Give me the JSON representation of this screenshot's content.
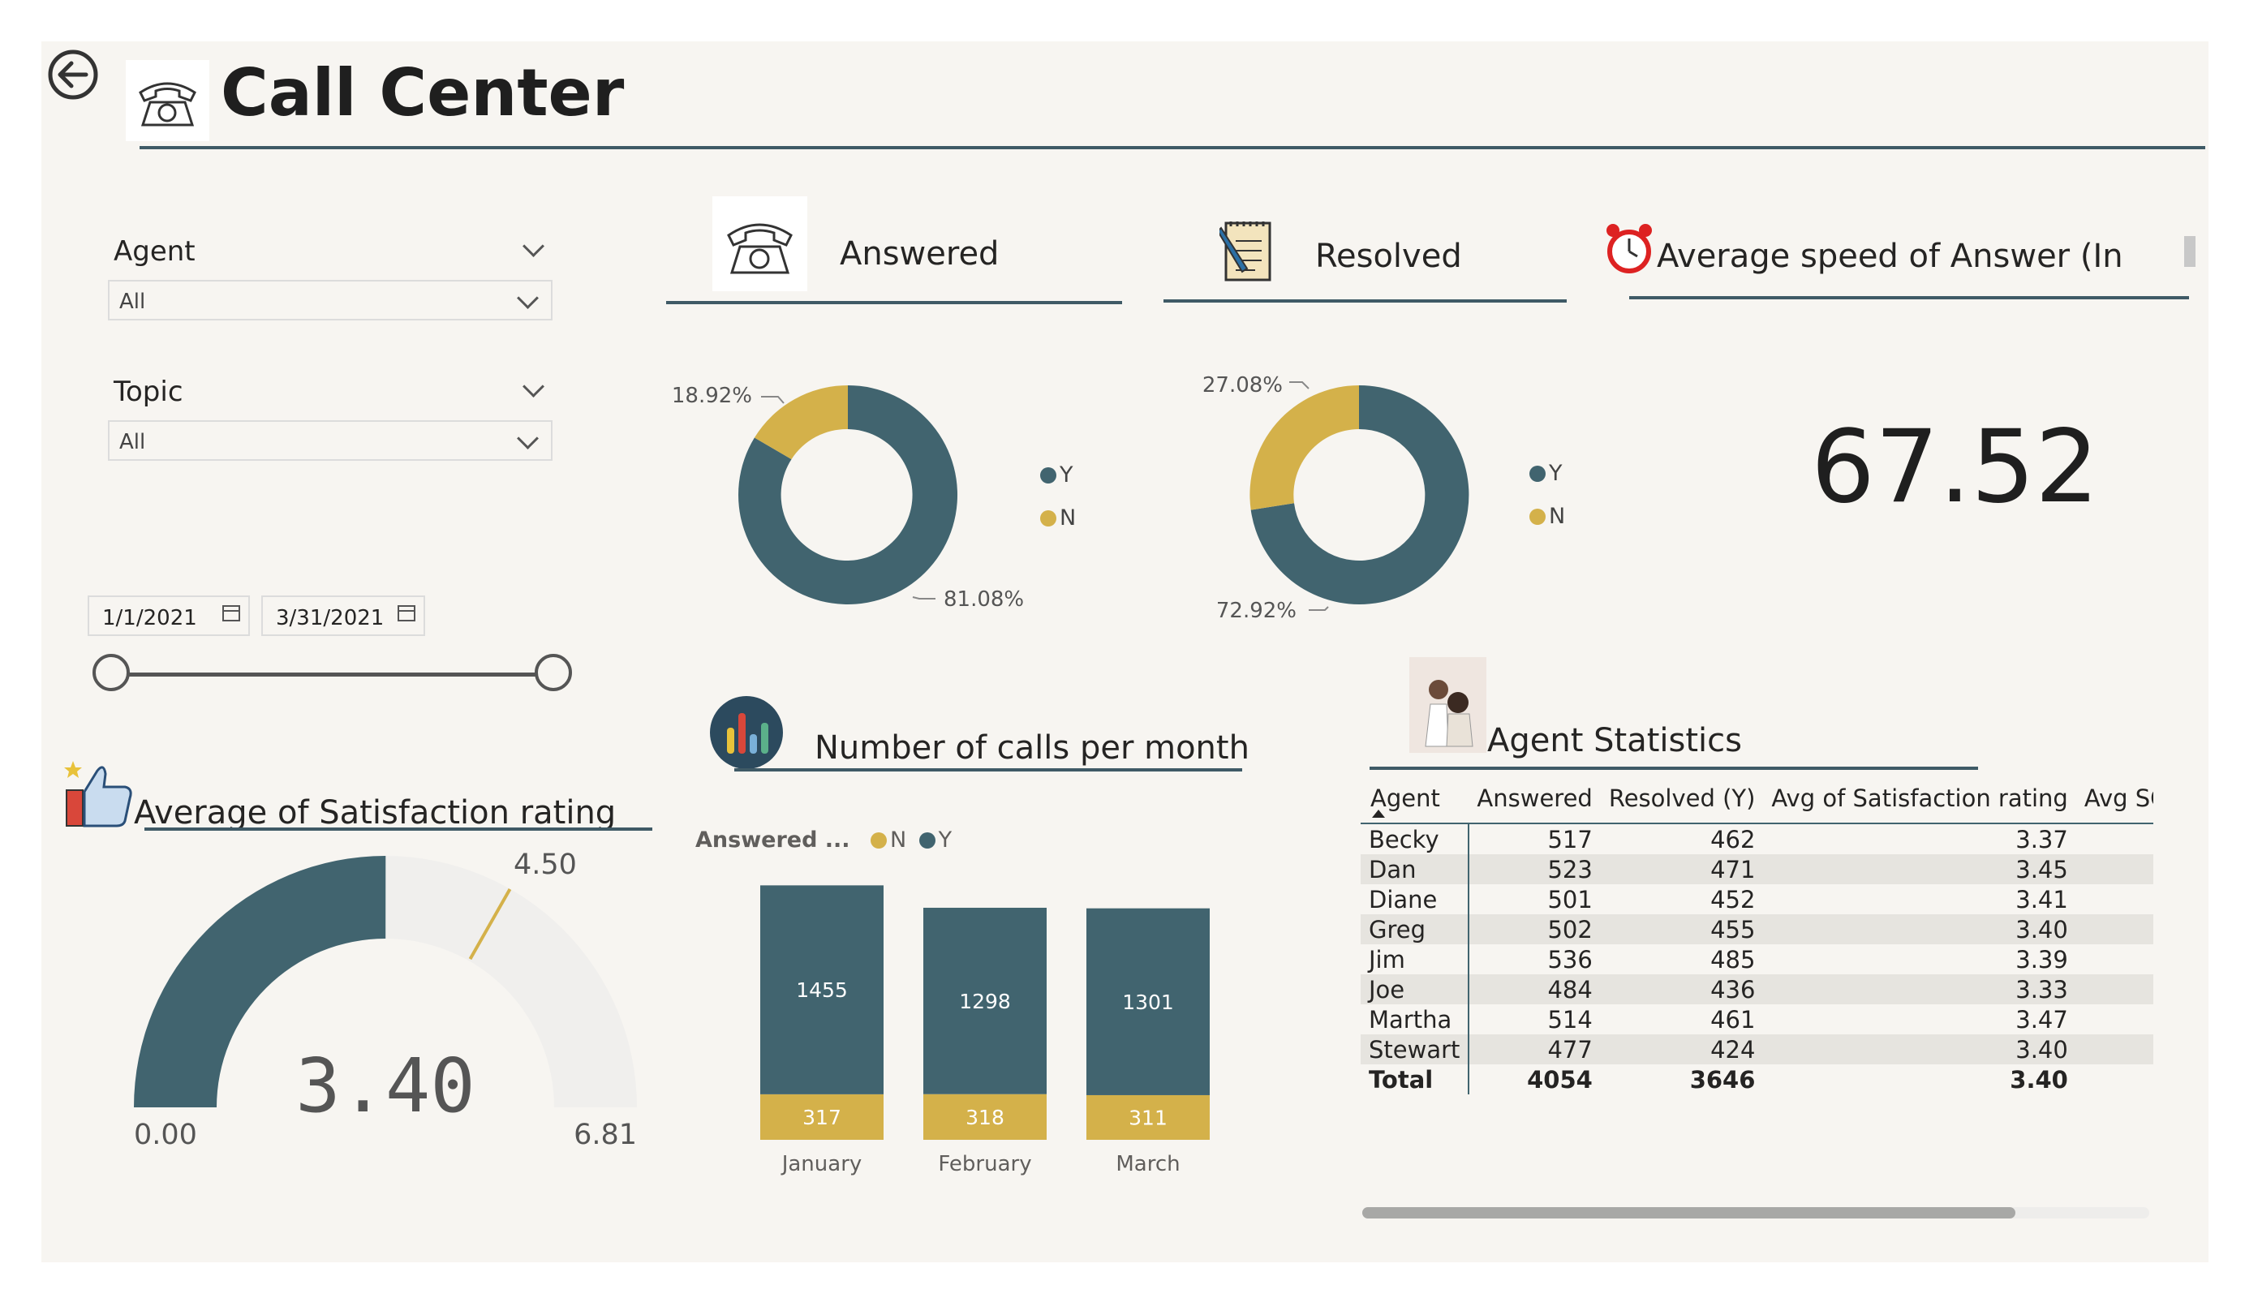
{
  "header": {
    "title": "Call Center"
  },
  "filters": {
    "agent": {
      "label": "Agent",
      "value": "All"
    },
    "topic": {
      "label": "Topic",
      "value": "All"
    },
    "date_start": "1/1/2021",
    "date_end": "3/31/2021"
  },
  "answered": {
    "title": "Answered",
    "legend_y": "Y",
    "legend_n": "N",
    "pct_y": "81.08%",
    "pct_n": "18.92%"
  },
  "resolved": {
    "title": "Resolved",
    "legend_y": "Y",
    "legend_n": "N",
    "pct_y": "72.92%",
    "pct_n": "27.08%"
  },
  "speed": {
    "title": "Average speed of Answer (In",
    "value": "67.52"
  },
  "satisfaction": {
    "title": "Average of Satisfaction rating",
    "value": "3.40",
    "min": "0.00",
    "max": "6.81",
    "target": "4.50"
  },
  "calls": {
    "title": "Number of calls per month",
    "legend_title": "Answered ...",
    "legend_n": "N",
    "legend_y": "Y"
  },
  "agents": {
    "title": "Agent Statistics",
    "columns": [
      "Agent",
      "Answered",
      "Resolved (Y)",
      "Avg of Satisfaction rating",
      "Avg SC"
    ],
    "rows": [
      [
        "Becky",
        "517",
        "462",
        "3.37"
      ],
      [
        "Dan",
        "523",
        "471",
        "3.45"
      ],
      [
        "Diane",
        "501",
        "452",
        "3.41"
      ],
      [
        "Greg",
        "502",
        "455",
        "3.40"
      ],
      [
        "Jim",
        "536",
        "485",
        "3.39"
      ],
      [
        "Joe",
        "484",
        "436",
        "3.33"
      ],
      [
        "Martha",
        "514",
        "461",
        "3.47"
      ],
      [
        "Stewart",
        "477",
        "424",
        "3.40"
      ]
    ],
    "total": [
      "Total",
      "4054",
      "3646",
      "3.40"
    ]
  },
  "colors": {
    "teal": "#41646f",
    "gold": "#d4b14a",
    "track": "#f0efed"
  },
  "chart_data": [
    {
      "type": "pie",
      "title": "Answered",
      "labels": [
        "Y",
        "N"
      ],
      "values": [
        81.08,
        18.92
      ]
    },
    {
      "type": "pie",
      "title": "Resolved",
      "labels": [
        "Y",
        "N"
      ],
      "values": [
        72.92,
        27.08
      ]
    },
    {
      "type": "bar",
      "title": "Number of calls per month",
      "categories": [
        "January",
        "February",
        "March"
      ],
      "series": [
        {
          "name": "N",
          "values": [
            317,
            318,
            311
          ]
        },
        {
          "name": "Y",
          "values": [
            1455,
            1298,
            1301
          ]
        }
      ]
    },
    {
      "type": "gauge",
      "title": "Average of Satisfaction rating",
      "value": 3.4,
      "min": 0.0,
      "max": 6.81,
      "target": 4.5
    }
  ]
}
